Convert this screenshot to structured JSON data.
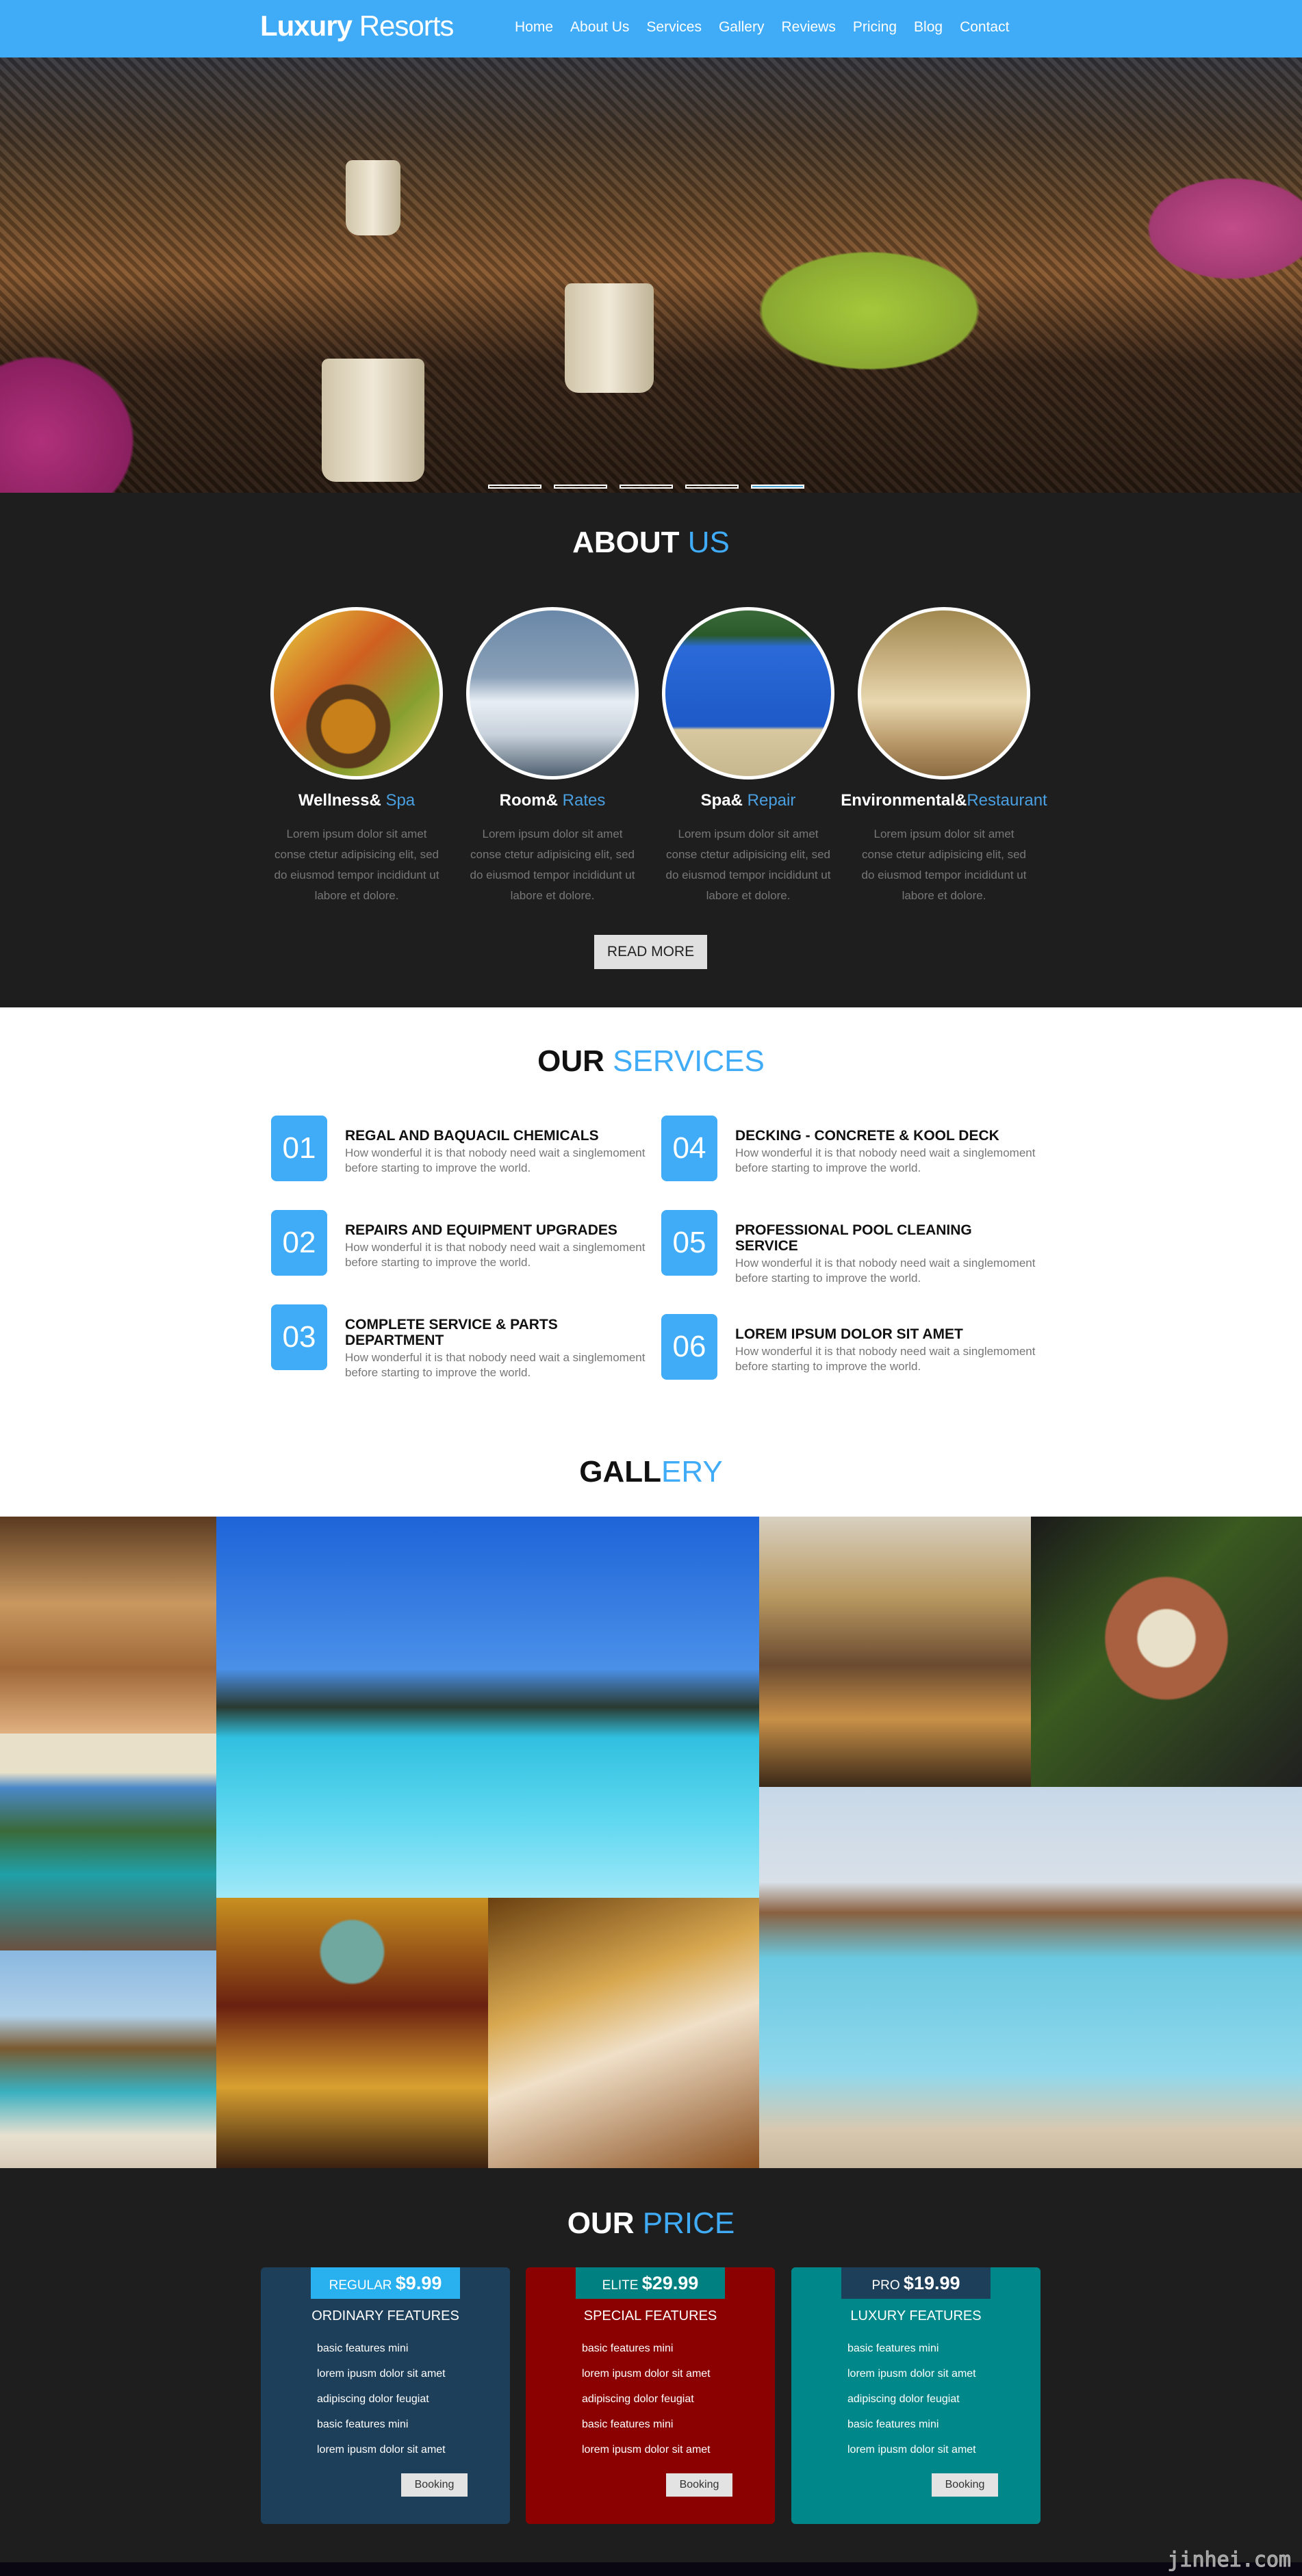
{
  "header": {
    "logo_bold": "Luxury",
    "logo_rest": " Resorts",
    "nav": [
      "Home",
      "About Us",
      "Services",
      "Gallery",
      "Reviews",
      "Pricing",
      "Blog",
      "Contact"
    ],
    "color": "#40abf7"
  },
  "hero": {
    "slides": 5,
    "active_slide": 5
  },
  "about": {
    "title_a": "ABOUT ",
    "title_b": "US",
    "items": [
      {
        "a": "Wellness& ",
        "b": "Spa",
        "text": "Lorem ipsum dolor sit amet conse ctetur adipisicing elit, sed do eiusmod tempor incididunt ut labore et dolore."
      },
      {
        "a": "Room& ",
        "b": "Rates",
        "text": "Lorem ipsum dolor sit amet conse ctetur adipisicing elit, sed do eiusmod tempor incididunt ut labore et dolore."
      },
      {
        "a": "Spa& ",
        "b": "Repair",
        "text": "Lorem ipsum dolor sit amet conse ctetur adipisicing elit, sed do eiusmod tempor incididunt ut labore et dolore."
      },
      {
        "a": "Environmental&",
        "b": "Restaurant",
        "text": "Lorem ipsum dolor sit amet conse ctetur adipisicing elit, sed do eiusmod tempor incididunt ut labore et dolore."
      }
    ],
    "button": "READ MORE"
  },
  "services": {
    "title_a": "OUR ",
    "title_b": "SERVICES",
    "items": [
      {
        "num": "01",
        "title": "REGAL AND BAQUACIL CHEMICALS",
        "desc": "How wonderful it is that nobody need wait a singlemoment before starting to improve the world."
      },
      {
        "num": "02",
        "title": "REPAIRS AND EQUIPMENT UPGRADES",
        "desc": "How wonderful it is that nobody need wait a singlemoment before starting to improve the world."
      },
      {
        "num": "03",
        "title": "COMPLETE SERVICE & PARTS DEPARTMENT",
        "desc": "How wonderful it is that nobody need wait a singlemoment before starting to improve the world."
      },
      {
        "num": "04",
        "title": "DECKING - CONCRETE & KOOL DECK",
        "desc": "How wonderful it is that nobody need wait a singlemoment before starting to improve the world."
      },
      {
        "num": "05",
        "title": "PROFESSIONAL POOL CLEANING SERVICE",
        "desc": "How wonderful it is that nobody need wait a singlemoment before starting to improve the world."
      },
      {
        "num": "06",
        "title": "LOREM IPSUM DOLOR SIT AMET",
        "desc": "How wonderful it is that nobody need wait a singlemoment before starting to improve the world."
      }
    ]
  },
  "gallery": {
    "title_a": "GALL",
    "title_b": "ERY"
  },
  "pricing": {
    "title_a": "OUR ",
    "title_b": "PRICE",
    "plans": [
      {
        "tier": "REGULAR ",
        "price": "$9.99",
        "features_title": "ORDINARY FEATURES",
        "features": [
          "basic features mini",
          "lorem ipusm dolor sit amet",
          "adipiscing dolor feugiat",
          "basic features mini",
          "lorem ipusm dolor sit amet"
        ],
        "button": "Booking",
        "card_color": "#1e3f5a",
        "tab_color": "#29b0ef"
      },
      {
        "tier": "ELITE ",
        "price": "$29.99",
        "features_title": "SPECIAL FEATURES",
        "features": [
          "basic features mini",
          "lorem ipusm dolor sit amet",
          "adipiscing dolor feugiat",
          "basic features mini",
          "lorem ipusm dolor sit amet"
        ],
        "button": "Booking",
        "card_color": "#8b0000",
        "tab_color": "#008080"
      },
      {
        "tier": "PRO ",
        "price": "$19.99",
        "features_title": "LUXURY FEATURES",
        "features": [
          "basic features mini",
          "lorem ipusm dolor sit amet",
          "adipiscing dolor feugiat",
          "basic features mini",
          "lorem ipusm dolor sit amet"
        ],
        "button": "Booking",
        "card_color": "#00878a",
        "tab_color": "#1e3f5a"
      }
    ]
  },
  "watermark": "jinhei.com"
}
